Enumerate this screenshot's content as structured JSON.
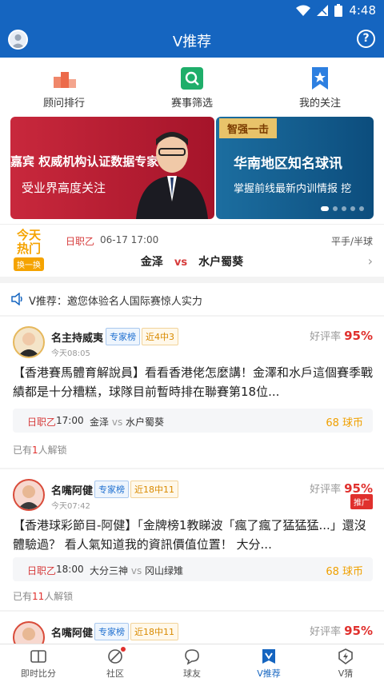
{
  "status_bar": {
    "time": "4:48"
  },
  "app_bar": {
    "title": "V推荐"
  },
  "quick_nav": [
    {
      "label": "顾问排行"
    },
    {
      "label": "赛事筛选"
    },
    {
      "label": "我的关注"
    }
  ],
  "banners": [
    {
      "text1": "嘉宾  权威机构认证数据专家",
      "text2": "受业界高度关注"
    },
    {
      "tag": "智强一击",
      "text1": "华南地区知名球讯",
      "text2": "掌握前线最新内训情报  挖"
    }
  ],
  "hot": {
    "badge_line1": "今天",
    "badge_line2": "热门",
    "switch_label": "换一换",
    "league": "日职乙",
    "time": "06-17 17:00",
    "bet_type": "平手/半球",
    "home": "金泽",
    "vs": "vs",
    "away": "水户蜀葵"
  },
  "notice": {
    "text": "V推荐：邀您体验名人国际赛惊人实力"
  },
  "cards": [
    {
      "name": "名主持威夷",
      "tag_expert": "专家榜",
      "tag_record": "近4中3",
      "time": "今天08:05",
      "rate_label": "好评率",
      "rate_value": "95%",
      "content": "【香港賽馬體育解說員】看看香港佬怎麼講！金澤和水戶這個賽季戰績都是十分糟糕，球隊目前暫時排在聯賽第18位...",
      "match": {
        "league": "日职乙",
        "time": "17:00",
        "home": "金泽",
        "vs": "vs",
        "away": "水户蜀葵",
        "coins": "68 球币"
      },
      "unlock_prefix": "已有",
      "unlock_count": "1",
      "unlock_suffix": "人解锁"
    },
    {
      "name": "名嘴阿健",
      "tag_expert": "专家榜",
      "tag_record": "近18中11",
      "time": "今天07:42",
      "rate_label": "好评率",
      "rate_value": "95%",
      "promo": "推广",
      "content": "【香港球彩節目-阿健】「金牌榜1教睇波「瘋了瘋了猛猛猛...」還沒體驗過？ 看人氣知道我的資訊價值位置！ 大分...",
      "match": {
        "league": "日职乙",
        "time": "18:00",
        "home": "大分三神",
        "vs": "vs",
        "away": "冈山绿雉",
        "coins": "68 球币"
      },
      "unlock_prefix": "已有",
      "unlock_count": "11",
      "unlock_suffix": "人解锁"
    },
    {
      "name": "名嘴阿健",
      "tag_expert": "专家榜",
      "tag_record": "近18中11",
      "rate_label": "好评率",
      "rate_value": "95%"
    }
  ],
  "tab_bar": [
    {
      "label": "即时比分",
      "icon": "scoreboard-icon"
    },
    {
      "label": "社区",
      "icon": "community-icon"
    },
    {
      "label": "球友",
      "icon": "chat-icon"
    },
    {
      "label": "V推荐",
      "icon": "v-recommend-icon"
    },
    {
      "label": "V猜",
      "icon": "lightning-icon"
    }
  ],
  "colors": {
    "primary": "#1565c0",
    "accent_red": "#e0302d",
    "coin": "#f0a000"
  }
}
